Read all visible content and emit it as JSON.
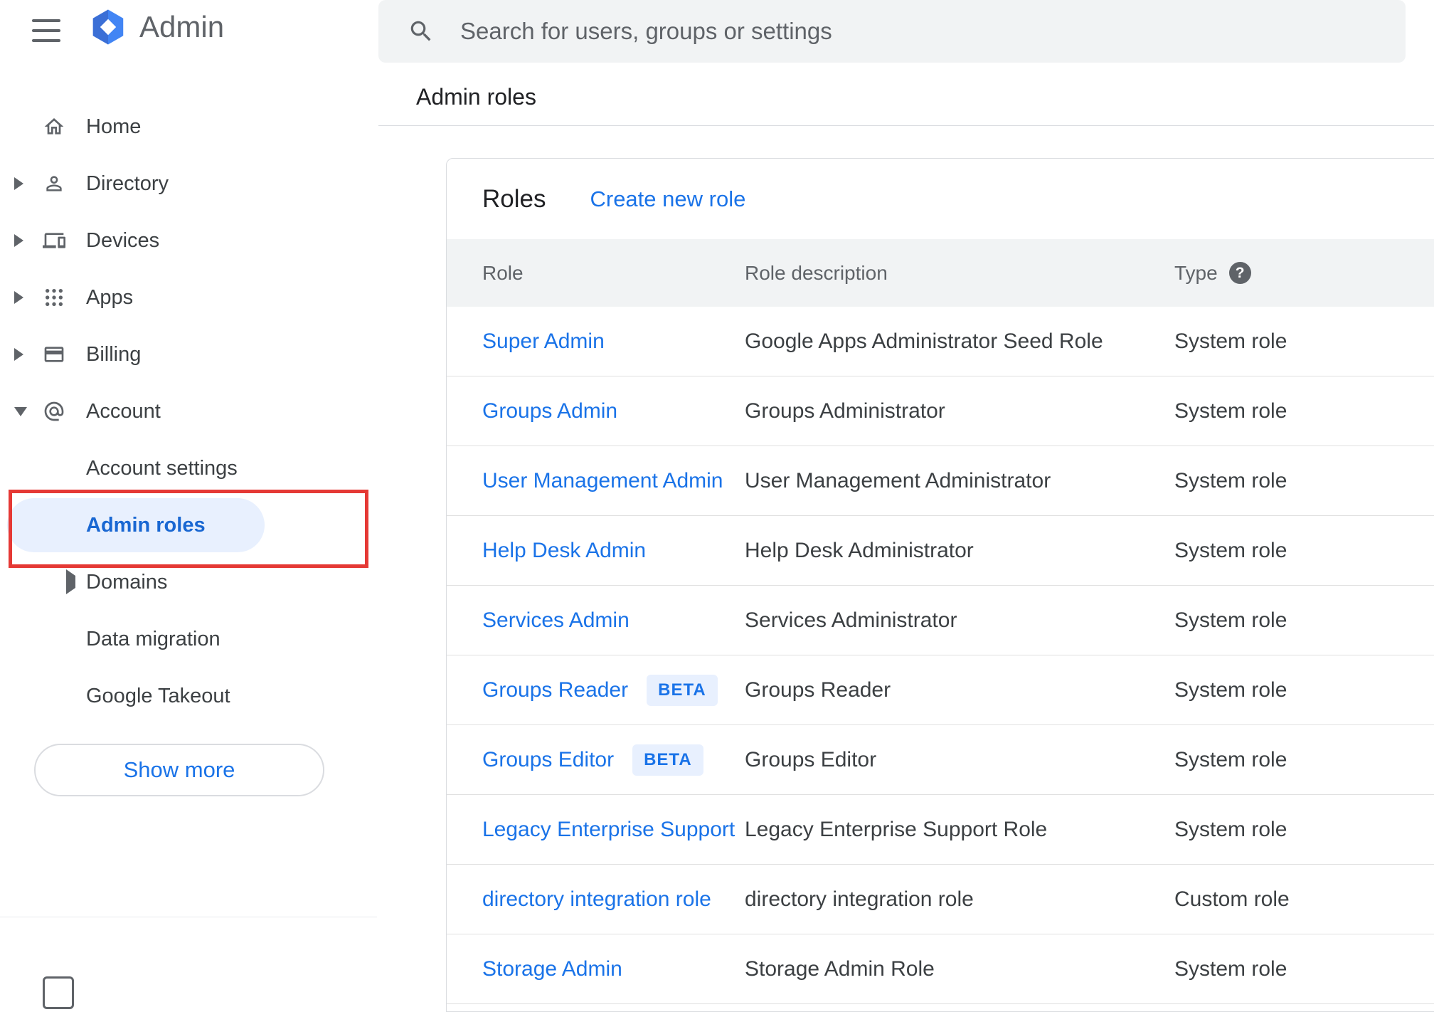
{
  "app": {
    "title": "Admin",
    "brand_color": "#4285f4"
  },
  "search": {
    "placeholder": "Search for users, groups or settings"
  },
  "breadcrumb": {
    "label": "Admin roles"
  },
  "sidebar": {
    "items": [
      {
        "label": "Home",
        "icon": "home-icon",
        "chevron": "none"
      },
      {
        "label": "Directory",
        "icon": "directory-icon",
        "chevron": "right"
      },
      {
        "label": "Devices",
        "icon": "devices-icon",
        "chevron": "right"
      },
      {
        "label": "Apps",
        "icon": "apps-icon",
        "chevron": "right"
      },
      {
        "label": "Billing",
        "icon": "billing-icon",
        "chevron": "right"
      },
      {
        "label": "Account",
        "icon": "account-icon",
        "chevron": "down"
      }
    ],
    "account_children": [
      {
        "label": "Account settings",
        "chevron": "none",
        "selected": false
      },
      {
        "label": "Admin roles",
        "chevron": "none",
        "selected": true
      },
      {
        "label": "Domains",
        "chevron": "right",
        "selected": false
      },
      {
        "label": "Data migration",
        "chevron": "none",
        "selected": false
      },
      {
        "label": "Google Takeout",
        "chevron": "none",
        "selected": false
      }
    ],
    "show_more": "Show more"
  },
  "roles": {
    "title": "Roles",
    "create_link": "Create new role",
    "columns": {
      "role": "Role",
      "description": "Role description",
      "type": "Type"
    },
    "beta_label": "BETA",
    "help_glyph": "?",
    "rows": [
      {
        "role": "Super Admin",
        "beta": false,
        "description": "Google Apps Administrator Seed Role",
        "type": "System role"
      },
      {
        "role": "Groups Admin",
        "beta": false,
        "description": "Groups Administrator",
        "type": "System role"
      },
      {
        "role": "User Management Admin",
        "beta": false,
        "description": "User Management Administrator",
        "type": "System role"
      },
      {
        "role": "Help Desk Admin",
        "beta": false,
        "description": "Help Desk Administrator",
        "type": "System role"
      },
      {
        "role": "Services Admin",
        "beta": false,
        "description": "Services Administrator",
        "type": "System role"
      },
      {
        "role": "Groups Reader",
        "beta": true,
        "description": "Groups Reader",
        "type": "System role"
      },
      {
        "role": "Groups Editor",
        "beta": true,
        "description": "Groups Editor",
        "type": "System role"
      },
      {
        "role": "Legacy Enterprise Support",
        "beta": false,
        "description": "Legacy Enterprise Support Role",
        "type": "System role"
      },
      {
        "role": "directory integration role",
        "beta": false,
        "description": "directory integration role",
        "type": "Custom role"
      },
      {
        "role": "Storage Admin",
        "beta": false,
        "description": "Storage Admin Role",
        "type": "System role"
      }
    ]
  },
  "annotation": {
    "type": "highlight-box",
    "color": "#e53935"
  },
  "colors": {
    "link": "#1a73e8",
    "selected_bg": "#e8f0fe",
    "selected_text": "#1967d2",
    "header_bg": "#f1f3f4"
  }
}
